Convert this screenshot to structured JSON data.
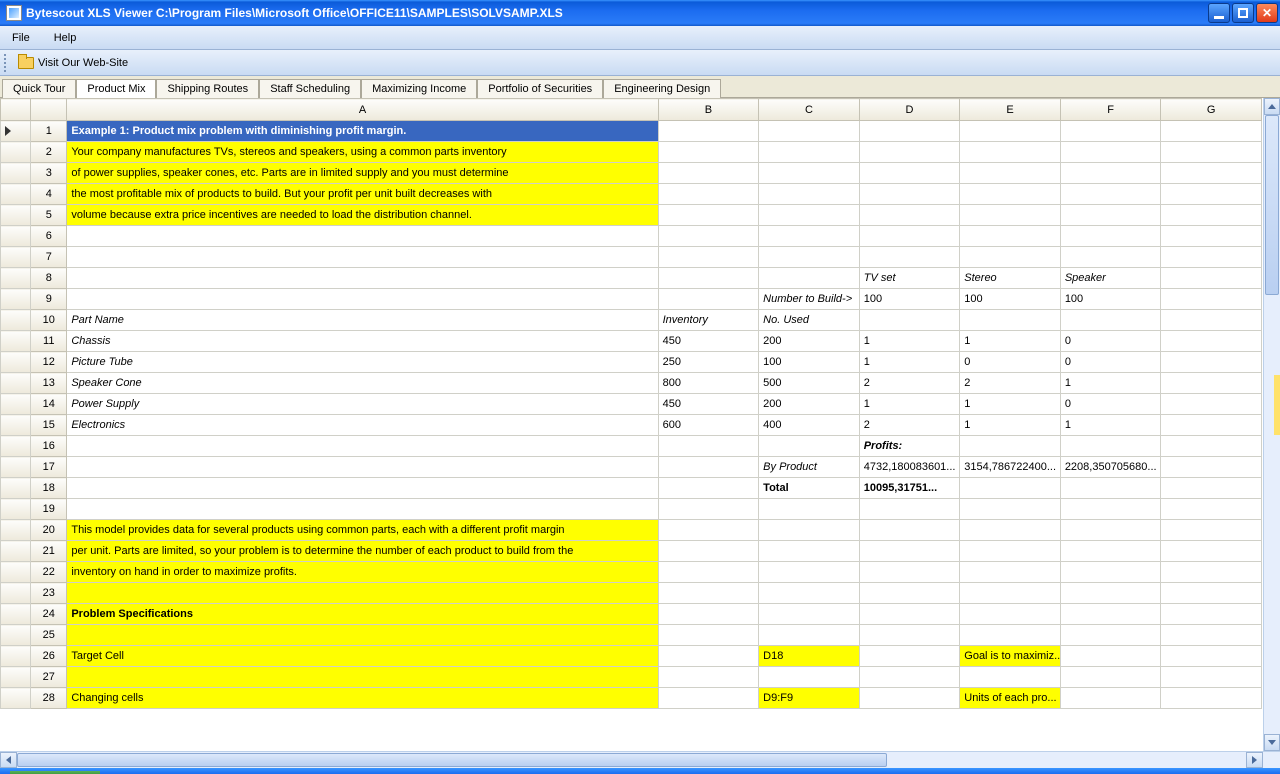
{
  "window": {
    "title": "Bytescout XLS Viewer C:\\Program Files\\Microsoft Office\\OFFICE11\\SAMPLES\\SOLVSAMP.XLS"
  },
  "menu": {
    "file": "File",
    "help": "Help"
  },
  "toolbar": {
    "visit": "Visit Our Web-Site"
  },
  "tabs": [
    "Quick Tour",
    "Product Mix",
    "Shipping Routes",
    "Staff Scheduling",
    "Maximizing Income",
    "Portfolio of Securities",
    "Engineering Design"
  ],
  "active_tab": 1,
  "columns": [
    "",
    "A",
    "B",
    "C",
    "D",
    "E",
    "F",
    "G"
  ],
  "rows": [
    {
      "n": 1,
      "ptr": true,
      "cells": {
        "A": {
          "t": "Example 1:  Product mix problem with diminishing profit margin.",
          "cls": "titlecell"
        }
      }
    },
    {
      "n": 2,
      "cells": {
        "A": {
          "t": "Your company manufactures TVs, stereos and speakers, using a common parts inventory",
          "cls": "yellow"
        }
      }
    },
    {
      "n": 3,
      "cells": {
        "A": {
          "t": "of power supplies, speaker cones, etc.  Parts are in limited supply and you must determine",
          "cls": "yellow"
        }
      }
    },
    {
      "n": 4,
      "cells": {
        "A": {
          "t": "the most profitable mix of products to build. But your profit per unit built decreases with",
          "cls": "yellow"
        }
      }
    },
    {
      "n": 5,
      "cells": {
        "A": {
          "t": "volume because extra price incentives are needed to load the distribution channel.",
          "cls": "yellow"
        }
      }
    },
    {
      "n": 6,
      "cells": {}
    },
    {
      "n": 7,
      "cells": {}
    },
    {
      "n": 8,
      "cells": {
        "D": {
          "t": "TV set",
          "cls": "italic"
        },
        "E": {
          "t": "Stereo",
          "cls": "italic"
        },
        "F": {
          "t": "Speaker",
          "cls": "italic"
        }
      }
    },
    {
      "n": 9,
      "cells": {
        "C": {
          "t": "Number to Build->",
          "cls": "italic"
        },
        "D": {
          "t": "100"
        },
        "E": {
          "t": "100"
        },
        "F": {
          "t": "100"
        }
      }
    },
    {
      "n": 10,
      "cells": {
        "A": {
          "t": "Part Name",
          "cls": "italic"
        },
        "B": {
          "t": "Inventory",
          "cls": "italic"
        },
        "C": {
          "t": "No. Used",
          "cls": "italic"
        }
      }
    },
    {
      "n": 11,
      "cells": {
        "A": {
          "t": "Chassis",
          "cls": "italic"
        },
        "B": {
          "t": "450"
        },
        "C": {
          "t": "200"
        },
        "D": {
          "t": "1"
        },
        "E": {
          "t": "1"
        },
        "F": {
          "t": "0"
        }
      }
    },
    {
      "n": 12,
      "cells": {
        "A": {
          "t": "Picture Tube",
          "cls": "italic"
        },
        "B": {
          "t": "250"
        },
        "C": {
          "t": "100"
        },
        "D": {
          "t": "1"
        },
        "E": {
          "t": "0"
        },
        "F": {
          "t": "0"
        }
      }
    },
    {
      "n": 13,
      "cells": {
        "A": {
          "t": "Speaker Cone",
          "cls": "italic"
        },
        "B": {
          "t": "800"
        },
        "C": {
          "t": "500"
        },
        "D": {
          "t": "2"
        },
        "E": {
          "t": "2"
        },
        "F": {
          "t": "1"
        }
      }
    },
    {
      "n": 14,
      "cells": {
        "A": {
          "t": "Power Supply",
          "cls": "italic"
        },
        "B": {
          "t": "450"
        },
        "C": {
          "t": "200"
        },
        "D": {
          "t": "1"
        },
        "E": {
          "t": "1"
        },
        "F": {
          "t": "0"
        }
      }
    },
    {
      "n": 15,
      "cells": {
        "A": {
          "t": "Electronics",
          "cls": "italic"
        },
        "B": {
          "t": "600"
        },
        "C": {
          "t": "400"
        },
        "D": {
          "t": "2"
        },
        "E": {
          "t": "1"
        },
        "F": {
          "t": "1"
        }
      }
    },
    {
      "n": 16,
      "cells": {
        "D": {
          "t": "Profits:",
          "cls": "bolditalic"
        }
      }
    },
    {
      "n": 17,
      "cells": {
        "C": {
          "t": "By Product",
          "cls": "italic"
        },
        "D": {
          "t": "4732,180083601..."
        },
        "E": {
          "t": "3154,786722400..."
        },
        "F": {
          "t": "2208,350705680..."
        }
      }
    },
    {
      "n": 18,
      "cells": {
        "C": {
          "t": "Total",
          "cls": "bold"
        },
        "D": {
          "t": "10095,31751...",
          "cls": "bold"
        }
      }
    },
    {
      "n": 19,
      "cells": {}
    },
    {
      "n": 20,
      "cells": {
        "A": {
          "t": "This model provides data for several products using common parts, each with a different profit margin",
          "cls": "yellow"
        }
      }
    },
    {
      "n": 21,
      "cells": {
        "A": {
          "t": "per unit.  Parts are limited, so your problem is to determine the number of each product to build from the",
          "cls": "yellow"
        }
      }
    },
    {
      "n": 22,
      "cells": {
        "A": {
          "t": "inventory on hand in order to maximize profits.",
          "cls": "yellow"
        }
      }
    },
    {
      "n": 23,
      "cells": {
        "A": {
          "t": "",
          "cls": "yellow"
        }
      }
    },
    {
      "n": 24,
      "cells": {
        "A": {
          "t": "Problem Specifications",
          "cls": "yellow bold"
        }
      }
    },
    {
      "n": 25,
      "cells": {
        "A": {
          "t": "",
          "cls": "yellow"
        }
      }
    },
    {
      "n": 26,
      "cells": {
        "A": {
          "t": "Target Cell",
          "cls": "yellow"
        },
        "C": {
          "t": "D18",
          "cls": "yellow"
        },
        "E": {
          "t": "Goal is to maximiz...",
          "cls": "yellow"
        }
      }
    },
    {
      "n": 27,
      "cells": {
        "A": {
          "t": "",
          "cls": "yellow"
        }
      }
    },
    {
      "n": 28,
      "cells": {
        "A": {
          "t": "Changing cells",
          "cls": "yellow"
        },
        "C": {
          "t": "D9:F9",
          "cls": "yellow"
        },
        "E": {
          "t": "Units of each pro...",
          "cls": "yellow"
        }
      }
    }
  ]
}
